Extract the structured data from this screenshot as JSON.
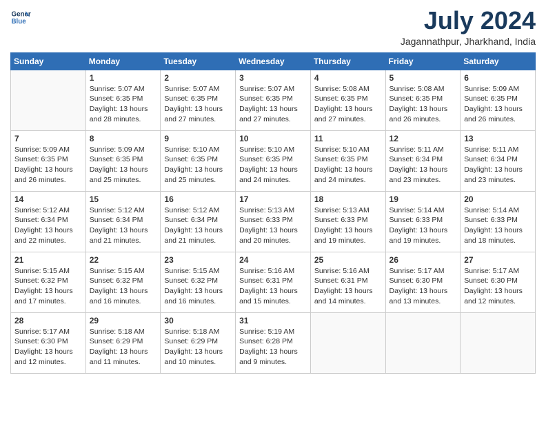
{
  "logo": {
    "line1": "General",
    "line2": "Blue"
  },
  "title": "July 2024",
  "location": "Jagannathpur, Jharkhand, India",
  "weekdays": [
    "Sunday",
    "Monday",
    "Tuesday",
    "Wednesday",
    "Thursday",
    "Friday",
    "Saturday"
  ],
  "weeks": [
    [
      {
        "day": "",
        "info": ""
      },
      {
        "day": "1",
        "info": "Sunrise: 5:07 AM\nSunset: 6:35 PM\nDaylight: 13 hours\nand 28 minutes."
      },
      {
        "day": "2",
        "info": "Sunrise: 5:07 AM\nSunset: 6:35 PM\nDaylight: 13 hours\nand 27 minutes."
      },
      {
        "day": "3",
        "info": "Sunrise: 5:07 AM\nSunset: 6:35 PM\nDaylight: 13 hours\nand 27 minutes."
      },
      {
        "day": "4",
        "info": "Sunrise: 5:08 AM\nSunset: 6:35 PM\nDaylight: 13 hours\nand 27 minutes."
      },
      {
        "day": "5",
        "info": "Sunrise: 5:08 AM\nSunset: 6:35 PM\nDaylight: 13 hours\nand 26 minutes."
      },
      {
        "day": "6",
        "info": "Sunrise: 5:09 AM\nSunset: 6:35 PM\nDaylight: 13 hours\nand 26 minutes."
      }
    ],
    [
      {
        "day": "7",
        "info": ""
      },
      {
        "day": "8",
        "info": "Sunrise: 5:09 AM\nSunset: 6:35 PM\nDaylight: 13 hours\nand 25 minutes."
      },
      {
        "day": "9",
        "info": "Sunrise: 5:10 AM\nSunset: 6:35 PM\nDaylight: 13 hours\nand 25 minutes."
      },
      {
        "day": "10",
        "info": "Sunrise: 5:10 AM\nSunset: 6:35 PM\nDaylight: 13 hours\nand 24 minutes."
      },
      {
        "day": "11",
        "info": "Sunrise: 5:10 AM\nSunset: 6:35 PM\nDaylight: 13 hours\nand 24 minutes."
      },
      {
        "day": "12",
        "info": "Sunrise: 5:11 AM\nSunset: 6:34 PM\nDaylight: 13 hours\nand 23 minutes."
      },
      {
        "day": "13",
        "info": "Sunrise: 5:11 AM\nSunset: 6:34 PM\nDaylight: 13 hours\nand 23 minutes."
      }
    ],
    [
      {
        "day": "14",
        "info": ""
      },
      {
        "day": "15",
        "info": "Sunrise: 5:12 AM\nSunset: 6:34 PM\nDaylight: 13 hours\nand 21 minutes."
      },
      {
        "day": "16",
        "info": "Sunrise: 5:12 AM\nSunset: 6:34 PM\nDaylight: 13 hours\nand 21 minutes."
      },
      {
        "day": "17",
        "info": "Sunrise: 5:13 AM\nSunset: 6:33 PM\nDaylight: 13 hours\nand 20 minutes."
      },
      {
        "day": "18",
        "info": "Sunrise: 5:13 AM\nSunset: 6:33 PM\nDaylight: 13 hours\nand 19 minutes."
      },
      {
        "day": "19",
        "info": "Sunrise: 5:14 AM\nSunset: 6:33 PM\nDaylight: 13 hours\nand 19 minutes."
      },
      {
        "day": "20",
        "info": "Sunrise: 5:14 AM\nSunset: 6:33 PM\nDaylight: 13 hours\nand 18 minutes."
      }
    ],
    [
      {
        "day": "21",
        "info": ""
      },
      {
        "day": "22",
        "info": "Sunrise: 5:15 AM\nSunset: 6:32 PM\nDaylight: 13 hours\nand 16 minutes."
      },
      {
        "day": "23",
        "info": "Sunrise: 5:15 AM\nSunset: 6:32 PM\nDaylight: 13 hours\nand 16 minutes."
      },
      {
        "day": "24",
        "info": "Sunrise: 5:16 AM\nSunset: 6:31 PM\nDaylight: 13 hours\nand 15 minutes."
      },
      {
        "day": "25",
        "info": "Sunrise: 5:16 AM\nSunset: 6:31 PM\nDaylight: 13 hours\nand 14 minutes."
      },
      {
        "day": "26",
        "info": "Sunrise: 5:17 AM\nSunset: 6:30 PM\nDaylight: 13 hours\nand 13 minutes."
      },
      {
        "day": "27",
        "info": "Sunrise: 5:17 AM\nSunset: 6:30 PM\nDaylight: 13 hours\nand 12 minutes."
      }
    ],
    [
      {
        "day": "28",
        "info": "Sunrise: 5:17 AM\nSunset: 6:30 PM\nDaylight: 13 hours\nand 12 minutes."
      },
      {
        "day": "29",
        "info": "Sunrise: 5:18 AM\nSunset: 6:29 PM\nDaylight: 13 hours\nand 11 minutes."
      },
      {
        "day": "30",
        "info": "Sunrise: 5:18 AM\nSunset: 6:29 PM\nDaylight: 13 hours\nand 10 minutes."
      },
      {
        "day": "31",
        "info": "Sunrise: 5:19 AM\nSunset: 6:28 PM\nDaylight: 13 hours\nand 9 minutes."
      },
      {
        "day": "",
        "info": ""
      },
      {
        "day": "",
        "info": ""
      },
      {
        "day": "",
        "info": ""
      }
    ]
  ],
  "week7_sunday": {
    "day": "7",
    "info": "Sunrise: 5:09 AM\nSunset: 6:35 PM\nDaylight: 13 hours\nand 26 minutes."
  },
  "week3_sunday": {
    "day": "14",
    "info": "Sunrise: 5:12 AM\nSunset: 6:34 PM\nDaylight: 13 hours\nand 22 minutes."
  },
  "week4_sunday": {
    "day": "21",
    "info": "Sunrise: 5:15 AM\nSunset: 6:32 PM\nDaylight: 13 hours\nand 17 minutes."
  }
}
